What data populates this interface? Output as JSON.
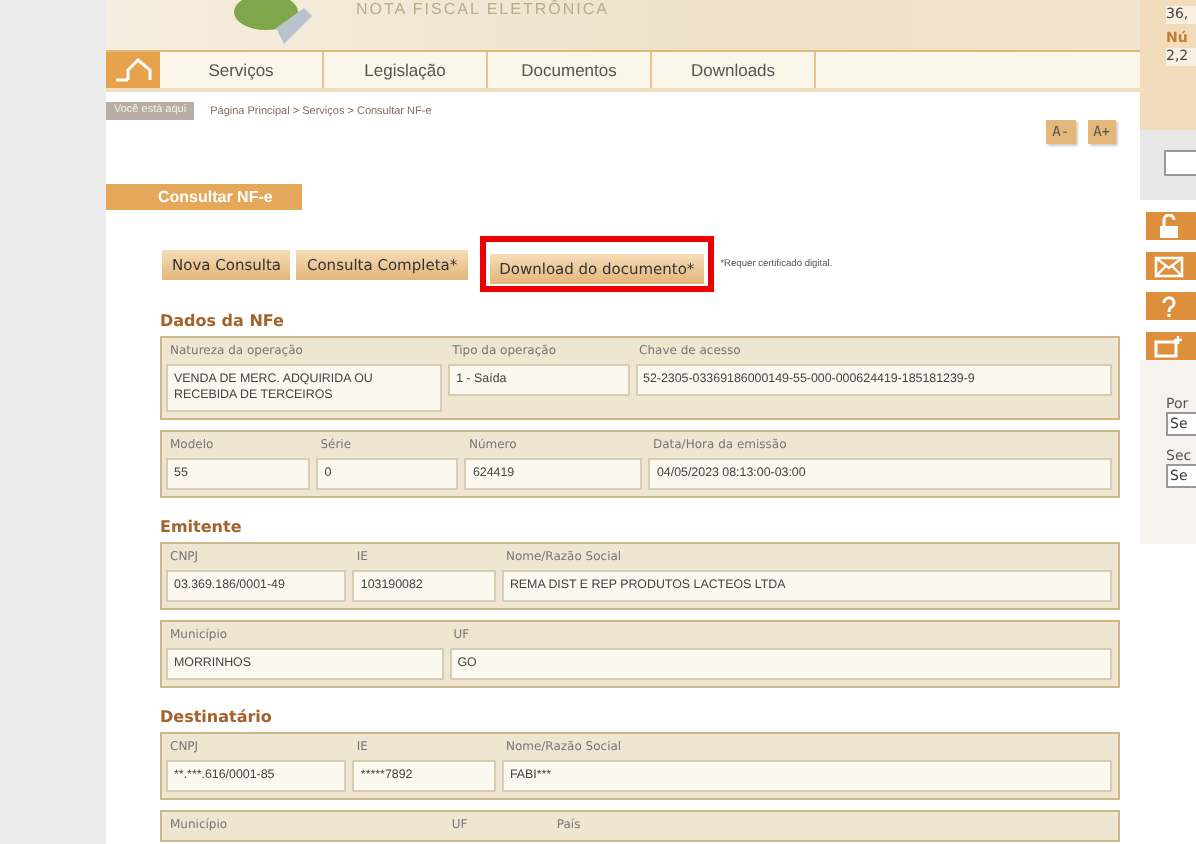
{
  "header": {
    "title": "NOTA FISCAL ELETRÔNICA"
  },
  "nav": {
    "items": [
      {
        "label": "Serviços",
        "selected": false
      },
      {
        "label": "Legislação",
        "selected": false
      },
      {
        "label": "Documentos",
        "selected": false
      },
      {
        "label": "Downloads",
        "selected": false
      }
    ]
  },
  "breadcrumb": {
    "badge": "Você está aqui",
    "path": "Página Principal > Serviços > Consultar NF-e"
  },
  "font_buttons": [
    "A-",
    "A+"
  ],
  "page_title": "Consultar NF-e",
  "actions": [
    {
      "label": "Nova Consulta",
      "highlighted": false
    },
    {
      "label": "Consulta Completa*",
      "highlighted": false
    },
    {
      "label": "Download do documento*",
      "highlighted": true
    }
  ],
  "note": "*Requer certificado digital.",
  "sections": [
    {
      "title": "Dados da NFe",
      "groups": [
        {
          "fields": [
            {
              "label": "Natureza da operação",
              "value": "VENDA DE MERC. ADQUIRIDA OU RECEBIDA DE TERCEIROS"
            },
            {
              "label": "Tipo da operação",
              "value": "1 - Saída"
            },
            {
              "label": "Chave de acesso",
              "value": "52-2305-03369186000149-55-000-000624419-185181239-9"
            }
          ]
        },
        {
          "fields": [
            {
              "label": "Modelo",
              "value": "55"
            },
            {
              "label": "Série",
              "value": "0"
            },
            {
              "label": "Número",
              "value": "624419"
            },
            {
              "label": "Data/Hora da emissão",
              "value": "04/05/2023 08:13:00-03:00"
            }
          ]
        }
      ]
    },
    {
      "title": "Emitente",
      "groups": [
        {
          "fields": [
            {
              "label": "CNPJ",
              "value": "03.369.186/0001-49"
            },
            {
              "label": "IE",
              "value": "103190082"
            },
            {
              "label": "Nome/Razão Social",
              "value": "REMA DIST E REP PRODUTOS LACTEOS LTDA"
            }
          ]
        },
        {
          "fields": [
            {
              "label": "Município",
              "value": "MORRINHOS"
            },
            {
              "label": "UF",
              "value": "GO"
            }
          ]
        }
      ]
    },
    {
      "title": "Destinatário",
      "groups": [
        {
          "fields": [
            {
              "label": "CNPJ",
              "value": "**.***.616/0001-85"
            },
            {
              "label": "IE",
              "value": "*****7892"
            },
            {
              "label": "Nome/Razão Social",
              "value": "FABI***"
            }
          ]
        },
        {
          "fields": [
            {
              "label": "Município"
            },
            {
              "label": "UF"
            },
            {
              "label": "País"
            }
          ]
        }
      ]
    }
  ],
  "sidebar": {
    "stats": [
      "36,",
      "Nú",
      "2,2"
    ],
    "tools": [
      {
        "kind": "lock"
      },
      {
        "kind": "mail"
      },
      {
        "kind": "help"
      },
      {
        "kind": "window"
      }
    ],
    "selects": [
      {
        "label": "Por",
        "value": "Se"
      },
      {
        "label": "Sec",
        "value": "Se"
      }
    ]
  }
}
